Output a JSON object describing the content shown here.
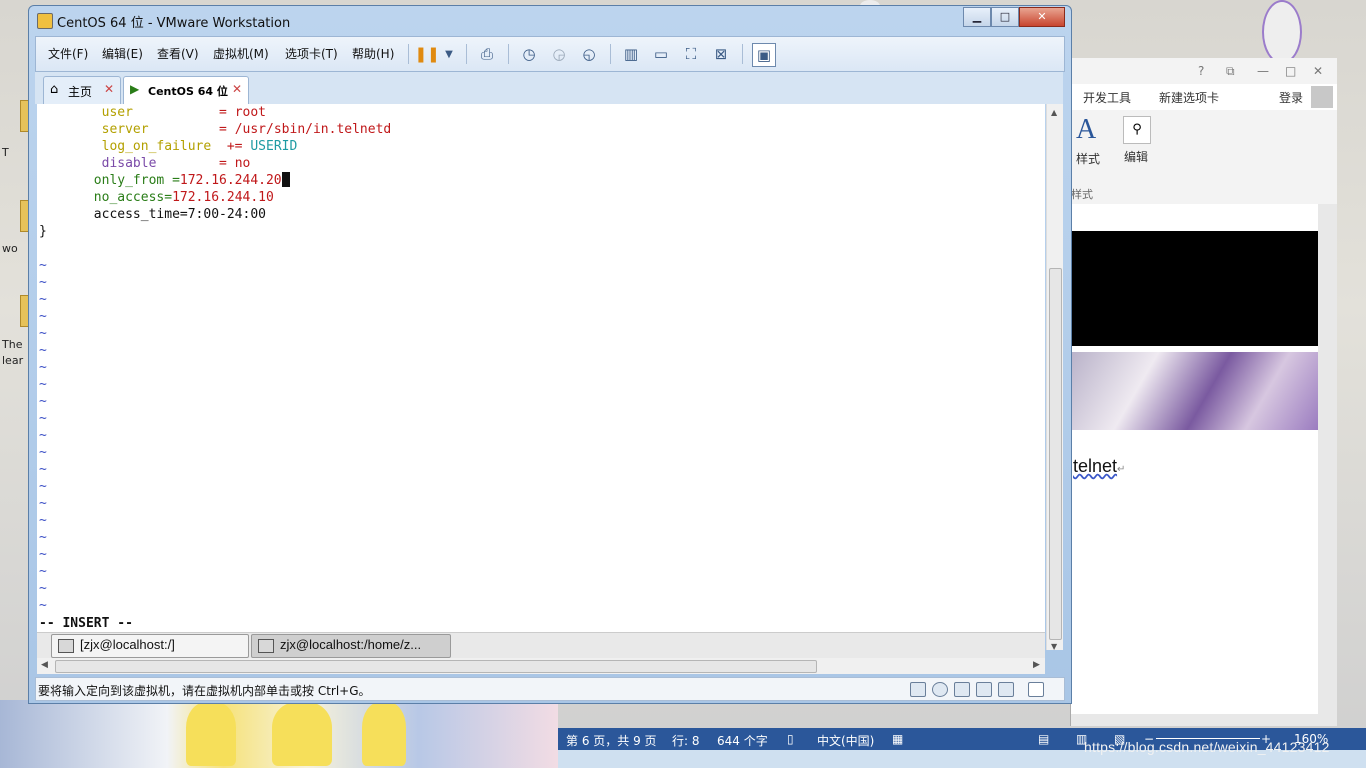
{
  "desktop": {
    "icon_labels": [
      "T",
      "wo",
      "The",
      "lear"
    ],
    "wallpaper_palette": [
      "#f6e27a",
      "#f2f2f2",
      "#c84a2a"
    ]
  },
  "vmware": {
    "title": "CentOS 64 位 - VMware Workstation",
    "window_buttons": {
      "minimize": "▁",
      "maximize": "□",
      "close": "✕"
    },
    "menu": [
      "文件(F)",
      "编辑(E)",
      "查看(V)",
      "虚拟机(M)",
      "选项卡(T)",
      "帮助(H)"
    ],
    "tabs": [
      {
        "label": "主页",
        "icon": "home-icon"
      },
      {
        "label": "CentOS 64 位",
        "icon": "vm-icon"
      }
    ],
    "terminal": {
      "config_lines": [
        {
          "key": "user",
          "op": "=",
          "value": "root"
        },
        {
          "key": "server",
          "op": "=",
          "value": "/usr/sbin/in.telnetd"
        },
        {
          "key": "log_on_failure",
          "op": "+=",
          "value": "USERID"
        },
        {
          "key": "disable",
          "op": "=",
          "value": "no"
        }
      ],
      "only_from_key": "only_from =",
      "only_from_value": "172.16.244.20",
      "no_access_key": "no_access=",
      "no_access_value": "172.16.244.10",
      "access_time": "access_time=7:00-24:00",
      "closing_brace": "}",
      "tilde": "~",
      "mode": "-- INSERT --"
    },
    "guest_taskbar": [
      {
        "label": "[zjx@localhost:/]"
      },
      {
        "label": "zjx@localhost:/home/z..."
      }
    ],
    "status_message": "要将输入定向到该虚拟机，请在虚拟机内部单击或按 Ctrl+G。"
  },
  "word": {
    "title_controls": [
      "?",
      "⧉",
      "—",
      "□",
      "✕"
    ],
    "ribbon_tabs": [
      "开发工具",
      "新建选项卡"
    ],
    "login": "登录",
    "styles_label": "样式",
    "edit_label": "编辑",
    "group_label": "样式",
    "doc_text": "telnet",
    "status": {
      "page": "第 6 页，共 9 页",
      "line": "行: 8",
      "words": "644 个字",
      "language": "中文(中国)",
      "zoom": "160%"
    }
  },
  "watermark": "https://blog.csdn.net/weixin_44123412"
}
